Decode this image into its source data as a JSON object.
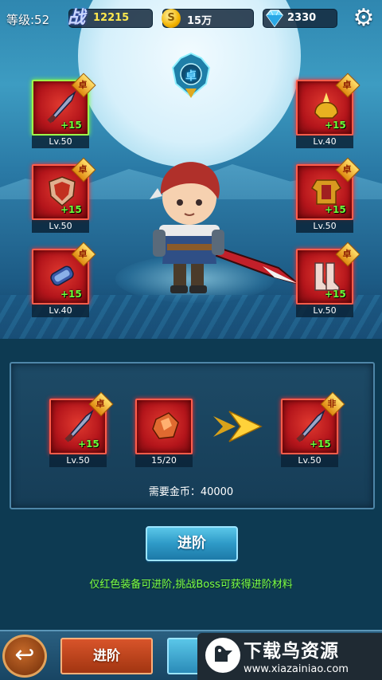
{
  "hud": {
    "level_label": "等级:52",
    "power_glyph": "战",
    "power_value": "12215",
    "coin_glyph": "S",
    "coin_value": "15万",
    "gem_value": "2330",
    "icons": [
      "power-icon",
      "coin-icon",
      "gem-icon",
      "gear-icon"
    ]
  },
  "emblem": {
    "text": "卓"
  },
  "equipment": {
    "left": [
      {
        "level": "Lv.50",
        "plus": "+15",
        "badge": "卓",
        "icon": "blade-icon",
        "selected": true
      },
      {
        "level": "Lv.50",
        "plus": "+15",
        "badge": "卓",
        "icon": "shield-icon"
      },
      {
        "level": "Lv.40",
        "plus": "+15",
        "badge": "卓",
        "icon": "bracer-icon"
      }
    ],
    "right": [
      {
        "level": "Lv.40",
        "plus": "+15",
        "badge": "卓",
        "icon": "helmet-icon"
      },
      {
        "level": "Lv.50",
        "plus": "+15",
        "badge": "卓",
        "icon": "armor-icon"
      },
      {
        "level": "Lv.50",
        "plus": "+15",
        "badge": "卓",
        "icon": "boots-icon"
      }
    ]
  },
  "upgrade": {
    "source": {
      "level": "Lv.50",
      "plus": "+15",
      "badge": "卓"
    },
    "material": {
      "count": "15/20"
    },
    "result": {
      "level": "Lv.50",
      "plus": "+15",
      "badge": "非"
    },
    "cost": "需要金币：40000",
    "button": "进阶",
    "hint": "仅红色装备可进阶,挑战Boss可获得进阶材料"
  },
  "bottom": {
    "back_glyph": "↩",
    "tab_active": "进阶"
  },
  "watermark": {
    "title": "下载鸟资源",
    "url": "www.xiazainiao.com"
  },
  "colors": {
    "slot_red": "#b4151b",
    "plus_green": "#6dff3a",
    "hint_green": "#7dff4a",
    "button_blue": "#2e9ac7",
    "tab_orange": "#c24a20"
  }
}
